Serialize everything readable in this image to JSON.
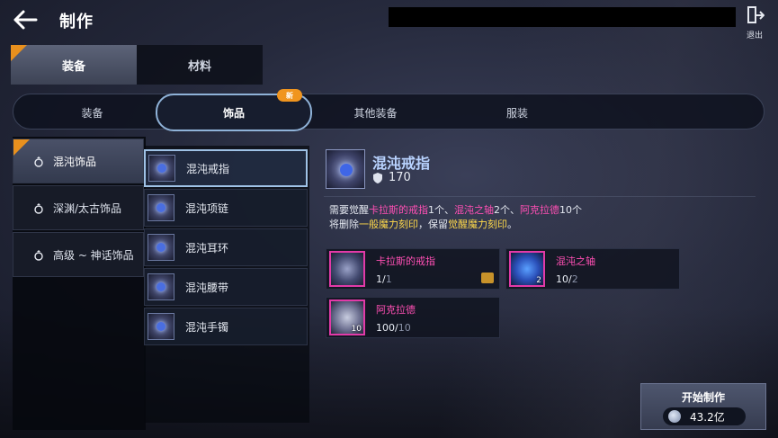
{
  "header": {
    "title": "制作",
    "exit_label": "退出"
  },
  "top_tabs": [
    {
      "label": "装备",
      "active": true,
      "new": true
    },
    {
      "label": "材料",
      "active": false,
      "new": false
    }
  ],
  "sub_tabs": [
    {
      "label": "装备",
      "active": false
    },
    {
      "label": "饰品",
      "active": true,
      "badge": "新"
    },
    {
      "label": "其他装备",
      "active": false
    },
    {
      "label": "服装",
      "active": false
    }
  ],
  "categories": [
    {
      "label": "混沌饰品",
      "active": true,
      "new": true
    },
    {
      "label": "深渊/太古饰品",
      "active": false
    },
    {
      "label": "高级 ~ 神话饰品",
      "active": false
    }
  ],
  "items": [
    {
      "name": "混沌戒指",
      "active": true
    },
    {
      "name": "混沌项链",
      "active": false
    },
    {
      "name": "混沌耳环",
      "active": false
    },
    {
      "name": "混沌腰带",
      "active": false
    },
    {
      "name": "混沌手镯",
      "active": false
    }
  ],
  "detail": {
    "name": "混沌戒指",
    "power": "170",
    "req_prefix": "需要觉醒",
    "req_item1": "卡拉斯的戒指",
    "req_count1": "1个、",
    "req_item2": "混沌之轴",
    "req_count2": "2个、",
    "req_item3": "阿克拉德",
    "req_count3": "10个",
    "req_line2_prefix": "将删除",
    "req_line2_hl1": "一般魔力刻印",
    "req_line2_mid": "，保留",
    "req_line2_hl2": "觉醒魔力刻印",
    "req_line2_suffix": "。"
  },
  "materials": [
    {
      "name": "卡拉斯的戒指",
      "have": "1/",
      "need": "1",
      "count": ""
    },
    {
      "name": "混沌之轴",
      "have": "10/",
      "need": "2",
      "count": "2"
    },
    {
      "name": "阿克拉德",
      "have": "100/",
      "need": "10",
      "count": "10"
    }
  ],
  "craft": {
    "label": "开始制作",
    "cost": "43.2亿"
  },
  "colors": {
    "highlight_pink": "#ff4fb4",
    "highlight_yellow": "#ffd94a",
    "badge_orange": "#f0951f",
    "active_border": "#9fc2e6"
  }
}
